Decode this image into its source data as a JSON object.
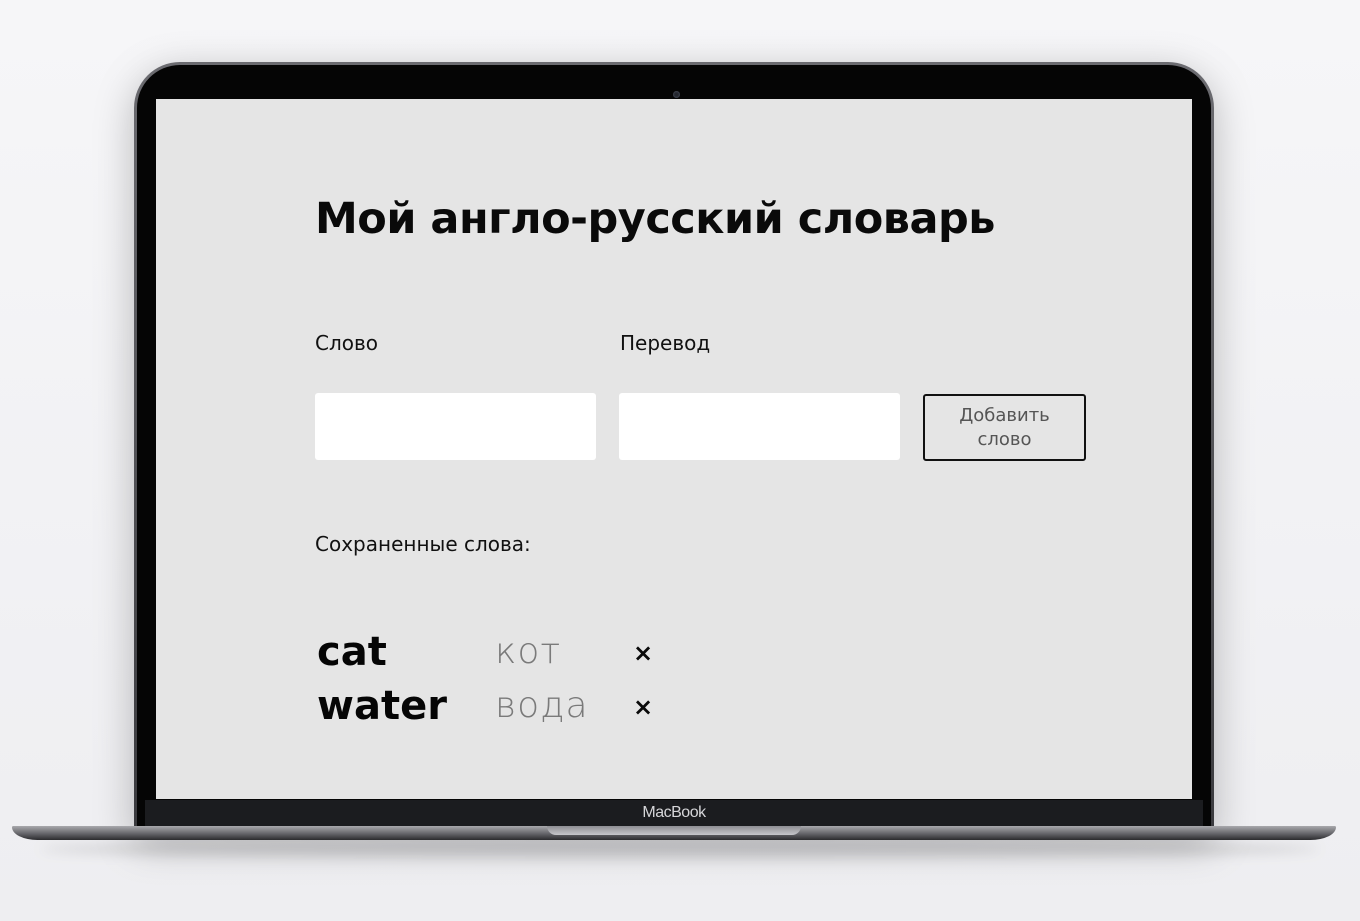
{
  "device": {
    "brand_label": "MacBook"
  },
  "app": {
    "title": "Мой англо-русский словарь",
    "form": {
      "word_label": "Слово",
      "translation_label": "Перевод",
      "word_value": "",
      "translation_value": "",
      "add_button_label": "Добавить слово"
    },
    "saved": {
      "heading": "Сохраненные слова:",
      "items": [
        {
          "word": "cat",
          "translation": "кот",
          "delete_icon": "×"
        },
        {
          "word": "water",
          "translation": "вода",
          "delete_icon": "×"
        }
      ]
    }
  }
}
